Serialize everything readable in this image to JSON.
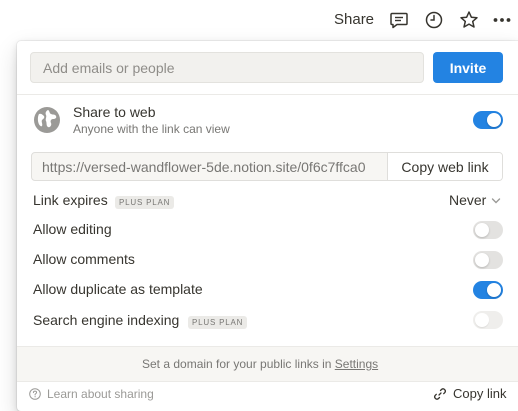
{
  "topbar": {
    "share_label": "Share",
    "icons": [
      "comment-icon",
      "history-icon",
      "star-icon",
      "more-icon"
    ]
  },
  "invite": {
    "placeholder": "Add emails or people",
    "button_label": "Invite"
  },
  "share_to_web": {
    "title": "Share to web",
    "subtitle": "Anyone with the link can view",
    "enabled": true,
    "url": "https://versed-wandflower-5de.notion.site/0f6c7ffca0",
    "copy_label": "Copy web link"
  },
  "options": {
    "link_expires": {
      "label": "Link expires",
      "badge": "PLUS PLAN",
      "value": "Never"
    },
    "allow_editing": {
      "label": "Allow editing",
      "enabled": false
    },
    "allow_comments": {
      "label": "Allow comments",
      "enabled": false
    },
    "allow_duplicate": {
      "label": "Allow duplicate as template",
      "enabled": true
    },
    "search_indexing": {
      "label": "Search engine indexing",
      "badge": "PLUS PLAN",
      "enabled": false,
      "disabled": true
    }
  },
  "footer": {
    "domain_text": "Set a domain for your public links in ",
    "settings_link": "Settings",
    "learn_label": "Learn about sharing",
    "copy_link_label": "Copy link"
  },
  "colors": {
    "accent": "#2383e2",
    "text": "#37352f",
    "muted": "#787774"
  }
}
